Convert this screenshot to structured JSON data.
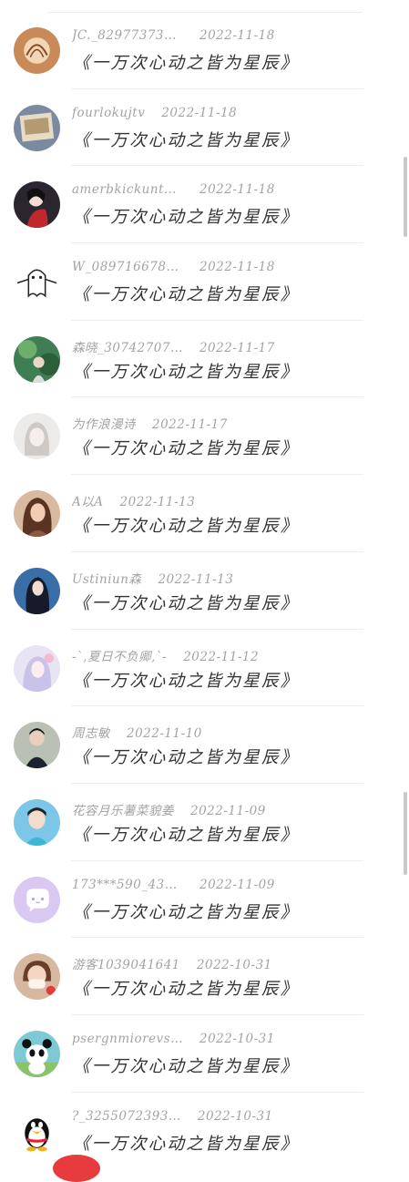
{
  "comments": [
    {
      "name": "JC._829773735…",
      "date": "2022-11-18",
      "text": "《一万次心动之皆为星辰》",
      "avatar": "shell"
    },
    {
      "name": "fourlokujtv",
      "date": "2022-11-18",
      "text": "《一万次心动之皆为星辰》",
      "avatar": "photo-frame"
    },
    {
      "name": "amerbkickuntouri…",
      "date": "2022-11-18",
      "text": "《一万次心动之皆为星辰》",
      "avatar": "anime-red"
    },
    {
      "name": "W_08971667866…",
      "date": "2022-11-18",
      "text": "《一万次心动之皆为星辰》",
      "avatar": "ghost-sketch"
    },
    {
      "name": "森晓_30742707…",
      "date": "2022-11-17",
      "text": "《一万次心动之皆为星辰》",
      "avatar": "green-scene"
    },
    {
      "name": "为作浪漫诗",
      "date": "2022-11-17",
      "text": "《一万次心动之皆为星辰》",
      "avatar": "sketch-girl"
    },
    {
      "name": "A以A",
      "date": "2022-11-13",
      "text": "《一万次心动之皆为星辰》",
      "avatar": "woman-portrait"
    },
    {
      "name": "Ustiniun森",
      "date": "2022-11-13",
      "text": "《一万次心动之皆为星辰》",
      "avatar": "anime-blue"
    },
    {
      "name": "-`,夏日不负卿,`-",
      "date": "2022-11-12",
      "text": "《一万次心动之皆为星辰》",
      "avatar": "pastel-girl"
    },
    {
      "name": "周志敏",
      "date": "2022-11-10",
      "text": "《一万次心动之皆为星辰》",
      "avatar": "selfie"
    },
    {
      "name": "花容月乐薯菜貌姜",
      "date": "2022-11-09",
      "text": "《一万次心动之皆为星辰》",
      "avatar": "child"
    },
    {
      "name": "173***590_434…",
      "date": "2022-11-09",
      "text": "《一万次心动之皆为星辰》",
      "avatar": "chat-bubble"
    },
    {
      "name": "游客1039041641",
      "date": "2022-10-31",
      "text": "《一万次心动之皆为星辰》",
      "avatar": "masked-face"
    },
    {
      "name": "psergnmiorevsfsi",
      "date": "2022-10-31",
      "text": "《一万次心动之皆为星辰》",
      "avatar": "panda"
    },
    {
      "name": "?_3255072393…",
      "date": "2022-10-31",
      "text": "《一万次心动之皆为星辰》",
      "avatar": "qq-penguin"
    }
  ],
  "colors": {
    "text": "#333333",
    "meta": "#a3a3a3",
    "divider": "#eeeeee",
    "accent": "#e83b3e"
  }
}
